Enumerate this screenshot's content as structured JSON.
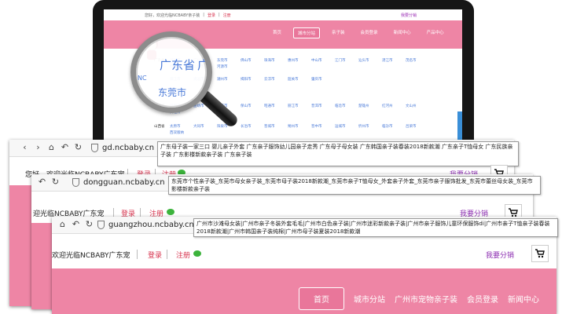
{
  "laptop": {
    "welcome": "您好，欢迎光临NCBABY亲子装",
    "login": "登录",
    "register": "注册",
    "sell": "我要分销",
    "nav": [
      "首页",
      "城市分站",
      "亲子装",
      "会员登录",
      "新闻中心",
      "产品中心"
    ],
    "row_heads": [
      "广东省",
      "云南省",
      "山西省"
    ],
    "cities": {
      "r1": [
        "深圳市",
        "广州市",
        "东莞市",
        "佛山市",
        "珠海市",
        "惠州市",
        "中山市",
        "江门市",
        "汕头市",
        "湛江市",
        "茂名市",
        "梅州市",
        "汕尾市",
        "河源市"
      ],
      "r2": [
        "阳江市",
        "清远市",
        "潮州市",
        "揭阳市",
        "云浮市",
        "韶关市",
        "肇庆市"
      ],
      "r3": [
        "昆明市",
        "曲靖市",
        "玉溪市",
        "保山市",
        "昭通市",
        "丽江市",
        "普洱市",
        "临沧市",
        "楚雄州",
        "红河州",
        "文山州",
        "大理州"
      ],
      "r4": [
        "太原市",
        "大同市",
        "阳泉市",
        "长治市",
        "晋城市",
        "朔州市",
        "晋中市",
        "运城市",
        "忻州市",
        "临汾市",
        "吕梁市",
        "西双版纳"
      ]
    }
  },
  "magnifier": {
    "province": "广东省",
    "city": "东莞市",
    "partial": "广",
    "prefix": "NC"
  },
  "win1": {
    "url": "gd.ncbaby.cn",
    "keywords": "广东母子装一家三口 婴儿亲子外套 广东亲子服饰幼儿园亲子走秀 广东母子母女装 广东韩国亲子装春装2018新款潮 广东亲子T恤母女 广东民族亲子装 广东影楼新款亲子装 广东亲子装",
    "welcome": "您好，欢迎光临NCBABY广东宠",
    "login": "登录",
    "register": "注册",
    "sell": "我要分销"
  },
  "win2": {
    "url": "dongguan.ncbaby.cn",
    "keywords": "东莞市个性亲子装_东莞市母女亲子装_东莞市母子装2018新款潮_东莞市亲子T恤母女_外套亲子外套_东莞市亲子服饰批发_东莞市蕾丝母女装_东莞市影楼新款亲子装",
    "welcome": "迎光临NCBABY广东宠",
    "login": "登录",
    "register": "注册",
    "sell": "我要分销"
  },
  "win3": {
    "url": "guangzhou.ncbaby.cn",
    "keywords": "广州市沙滩母女装|广州市亲子冬装外套毛毛|广州市白色亲子装|广州市迷彩新款亲子装|广州市亲子服饰儿童环保服饰di|广州市亲子T恤亲子装春装2018新款潮|广州市韩国亲子装纯棉|广州市母子装夏装2018新款潮",
    "welcome": "欢迎光临NCBABY广东宠",
    "login": "登录",
    "register": "注册",
    "sell": "我要分销",
    "nav": [
      "首页",
      "城市分站",
      "广州市宠物亲子装",
      "会员登录",
      "新闻中心"
    ]
  },
  "colors": {
    "pink": "#ee85a5",
    "red_link": "#d7334e",
    "purple_link": "#8b2cb0",
    "city_blue": "#4a7ad8"
  },
  "icons": [
    "back-arrow-icon",
    "forward-arrow-icon",
    "home-icon",
    "undo-icon",
    "refresh-icon",
    "shield-icon",
    "cart-icon",
    "wechat-icon",
    "magnifier-icon"
  ]
}
